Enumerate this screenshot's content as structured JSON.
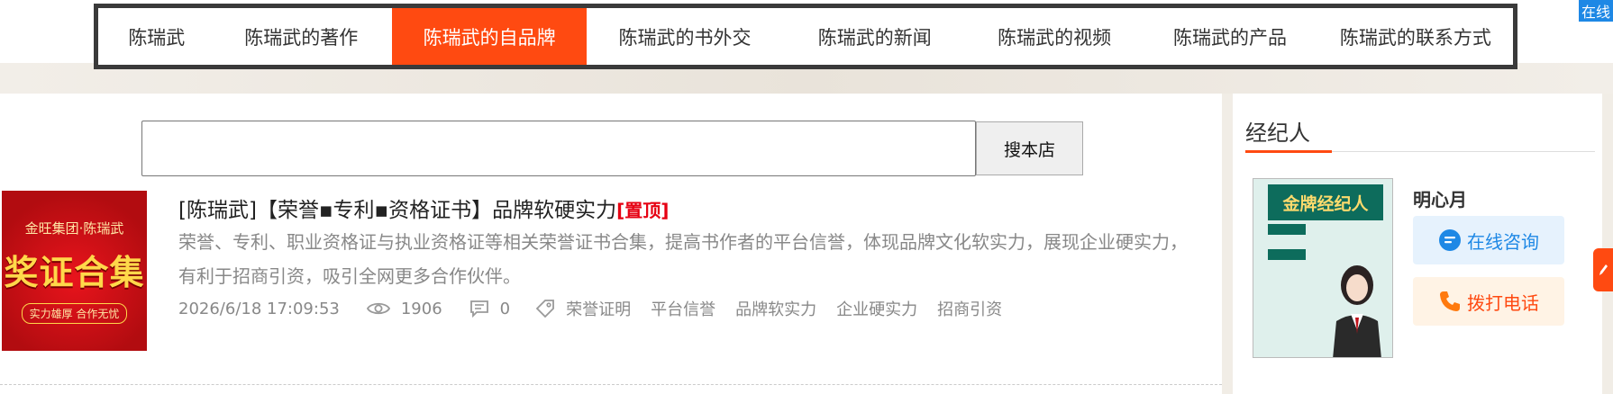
{
  "nav": {
    "items": [
      {
        "label": "陈瑞武",
        "width": 120
      },
      {
        "label": "陈瑞武的著作",
        "width": 202
      },
      {
        "label": "陈瑞武的自品牌",
        "width": 217,
        "active": true
      },
      {
        "label": "陈瑞武的书外交",
        "width": 218
      },
      {
        "label": "陈瑞武的新闻",
        "width": 205
      },
      {
        "label": "陈瑞武的视频",
        "width": 195
      },
      {
        "label": "陈瑞武的产品",
        "width": 196
      },
      {
        "label": "陈瑞武的联系方式",
        "width": 217
      }
    ]
  },
  "corner_badge": "在线",
  "search": {
    "value": "",
    "placeholder": "",
    "button_label": "搜本店"
  },
  "article": {
    "thumb_line1": "金旺集团·陈瑞武",
    "thumb_line2": "奖证合集",
    "thumb_line3": "实力雄厚 合作无忧",
    "title": "[陈瑞武]【荣誉▪专利▪资格证书】品牌软硬实力",
    "pin_label": "[置顶]",
    "description": "荣誉、专利、职业资格证与执业资格证等相关荣誉证书合集，提高书作者的平台信誉，体现品牌文化软实力，展现企业硬实力，有利于招商引资，吸引全网更多合作伙伴。",
    "date": "2026/6/18 17:09:53",
    "views": "1906",
    "comments": "0",
    "tags": [
      "荣誉证明",
      "平台信誉",
      "品牌软实力",
      "企业硬实力",
      "招商引资"
    ]
  },
  "sidebar": {
    "heading": "经纪人",
    "poster_title": "金牌经纪人",
    "agent_name": "明心月",
    "consult_label": "在线咨询",
    "call_label": "拨打电话"
  },
  "colors": {
    "accent": "#ff4a11",
    "nav_border": "#3a3a3a",
    "consult_blue": "#1e88e5",
    "pin_red": "#e60012"
  },
  "icons": {
    "views": "eye-icon",
    "comments": "comment-icon",
    "tags": "tag-icon",
    "consult": "chat-icon",
    "call": "phone-icon"
  }
}
